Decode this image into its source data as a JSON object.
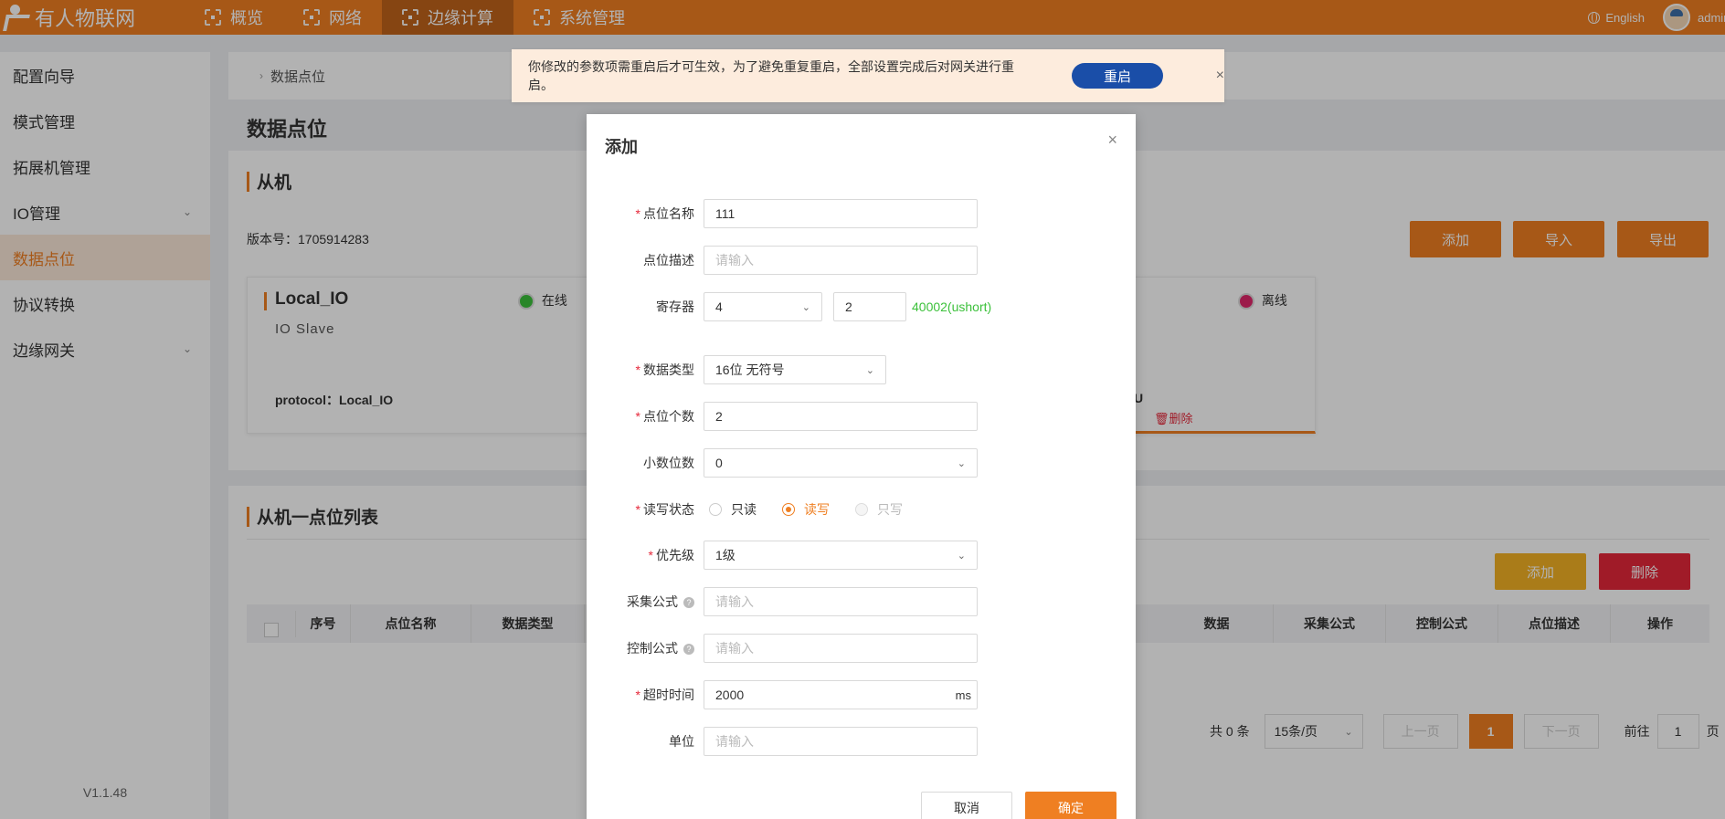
{
  "app": {
    "brand": "有人物联网",
    "nav": [
      {
        "label": "概览"
      },
      {
        "label": "网络"
      },
      {
        "label": "边缘计算"
      },
      {
        "label": "系统管理"
      }
    ],
    "language": "English",
    "user": "admin"
  },
  "sidebar": {
    "items": [
      {
        "label": "配置向导"
      },
      {
        "label": "模式管理"
      },
      {
        "label": "拓展机管理"
      },
      {
        "label": "IO管理"
      },
      {
        "label": "数据点位"
      },
      {
        "label": "协议转换"
      },
      {
        "label": "边缘网关"
      }
    ],
    "version": "V1.1.48"
  },
  "breadcrumb": {
    "current": "数据点位"
  },
  "banner": {
    "message": "你修改的参数项需重启后才可生效，为了避免重复重启，全部设置完成后对网关进行重启。",
    "restart_label": "重启",
    "close": "×"
  },
  "page": {
    "title": "数据点位",
    "slave_section": "从机",
    "version_text": "版本号：1705914283",
    "buttons": {
      "add": "添加",
      "import": "导入",
      "export": "导出"
    },
    "cards": [
      {
        "name": "Local_IO",
        "type": "IO Slave",
        "status": "在线",
        "protocol": "protocol：Local_IO"
      },
      {
        "status": "离线",
        "protocol_fragment": "U",
        "delete_label": "删除"
      }
    ],
    "point_list_title": "从机一点位列表",
    "list_buttons": {
      "add": "添加",
      "delete": "删除"
    },
    "columns": [
      "序号",
      "点位名称",
      "数据类型",
      "数据",
      "采集公式",
      "控制公式",
      "点位描述",
      "操作"
    ],
    "pager": {
      "total": "共 0 条",
      "page_size": "15条/页",
      "prev": "上一页",
      "current": "1",
      "next": "下一页",
      "goto_prefix": "前往",
      "goto_value": "1",
      "goto_suffix": "页"
    }
  },
  "modal": {
    "title": "添加",
    "close": "×",
    "fields": {
      "name": {
        "label": "点位名称",
        "value": "111"
      },
      "desc": {
        "label": "点位描述",
        "placeholder": "请输入"
      },
      "register": {
        "label": "寄存器",
        "type_value": "4",
        "address_value": "2",
        "hint": "40002(ushort)"
      },
      "datatype": {
        "label": "数据类型",
        "value": "16位 无符号"
      },
      "count": {
        "label": "点位个数",
        "value": "2"
      },
      "decimal": {
        "label": "小数位数",
        "value": "0"
      },
      "rw": {
        "label": "读写状态",
        "options": [
          "只读",
          "读写",
          "只写"
        ]
      },
      "priority": {
        "label": "优先级",
        "value": "1级"
      },
      "collect_formula": {
        "label": "采集公式",
        "placeholder": "请输入"
      },
      "control_formula": {
        "label": "控制公式",
        "placeholder": "请输入"
      },
      "timeout": {
        "label": "超时时间",
        "value": "2000",
        "unit": "ms"
      },
      "unit": {
        "label": "单位",
        "placeholder": "请输入"
      }
    },
    "cancel_label": "取消",
    "confirm_label": "确定"
  },
  "colors": {
    "brand": "#ef7f22",
    "restart_button": "#1a4ea8",
    "hint_green": "#3cc13b",
    "online": "#3cc13b",
    "offline": "#e0286a",
    "delete": "#e6283a",
    "add_yellow": "#f4b224"
  }
}
